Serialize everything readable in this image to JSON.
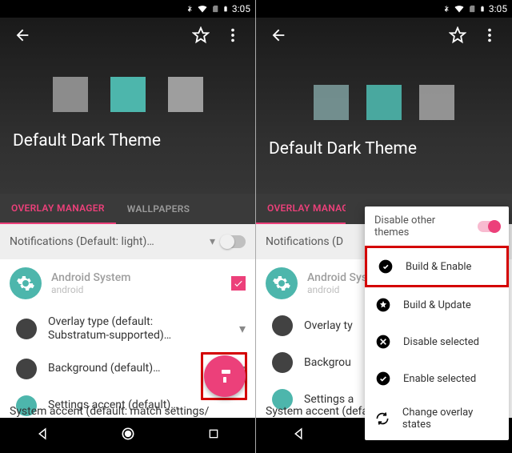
{
  "status": {
    "time": "3:05"
  },
  "header": {
    "title": "Default Dark Theme",
    "swatches": [
      "#8c8c8c",
      "#4db6ac",
      "#9e9e9e"
    ]
  },
  "tabs": {
    "overlay": "OVERLAY MANAGER",
    "wallpapers": "WALLPAPERS"
  },
  "notif_row": {
    "label": "Notifications (Default: light)…",
    "label_short": "Notifications (D"
  },
  "system": {
    "title": "Android System",
    "subtitle": "android"
  },
  "options": {
    "overlay_type": "Overlay type (default: Substratum-supported)…",
    "background": "Background (default)…",
    "settings_accent": "Settings accent (default)…",
    "system_accent": "System accent (default: match settings/"
  },
  "popup": {
    "disable_others": "Disable other themes",
    "items": [
      {
        "label": "Build & Enable",
        "icon": "check-badge"
      },
      {
        "label": "Build & Update",
        "icon": "star-circle"
      },
      {
        "label": "Disable selected",
        "icon": "x-circle"
      },
      {
        "label": "Enable selected",
        "icon": "check-circle"
      },
      {
        "label": "Change overlay states",
        "icon": "refresh"
      }
    ]
  },
  "colors": {
    "accent": "#ec407a",
    "teal": "#4db6ac"
  }
}
